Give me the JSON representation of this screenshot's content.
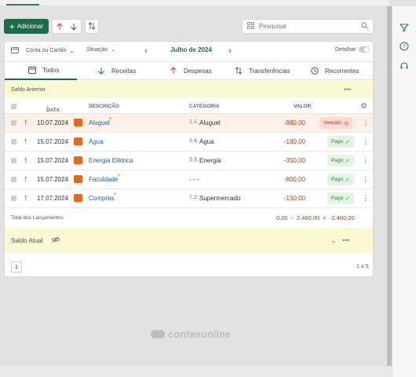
{
  "toolbar": {
    "add_label": "Adicionar",
    "search_placeholder": "Pesquisar"
  },
  "filters": {
    "account": "Conta ou Cartão",
    "status": "Situação",
    "period": "Julho de 2024",
    "detail": "Detalhar"
  },
  "tabs": [
    {
      "label": "Todos",
      "active": true
    },
    {
      "label": "Receitas",
      "active": false
    },
    {
      "label": "Despesas",
      "active": false
    },
    {
      "label": "Transferências",
      "active": false
    },
    {
      "label": "Recorrentes",
      "active": false
    }
  ],
  "previous_balance_label": "Saldo Anterior",
  "table": {
    "headers": {
      "date": "DATA",
      "description": "DESCRIÇÃO",
      "category": "CATEGORIA",
      "value": "VALOR"
    },
    "rows": [
      {
        "date": "10.07.2024",
        "description": "Aluguel",
        "category_code": "1.1.",
        "category": "Aluguel",
        "value": "-980,00",
        "status": "Vencido",
        "overdue": true
      },
      {
        "date": "15.07.2024",
        "description": "Água",
        "category_code": "3.4.",
        "category": "Água",
        "value": "-180,00",
        "status": "Pago",
        "overdue": false
      },
      {
        "date": "15.07.2024",
        "description": "Energia Elétrica",
        "category_code": "3.3.",
        "category": "Energia",
        "value": "-350,00",
        "status": "Pago",
        "overdue": false
      },
      {
        "date": "15.07.2024",
        "description": "Faculdade",
        "category_code": "",
        "category": "- - -",
        "value": "-800,00",
        "status": "Pago",
        "overdue": false
      },
      {
        "date": "17.07.2024",
        "description": "Compras",
        "category_code": "7.2.",
        "category": "Supermercado",
        "value": "-150,00",
        "status": "Pago",
        "overdue": false
      }
    ]
  },
  "totals": {
    "label": "Total dos Lançamentos",
    "income": "0,00",
    "minus": "-",
    "expense": "2.460,00",
    "equals": "=",
    "result": "-2.460,00"
  },
  "current_balance_label": "Saldo Atual",
  "pagination": {
    "page": "1",
    "range": "1 a 5"
  },
  "brand": "contasonline",
  "colors": {
    "primary": "#1d6b47",
    "negative": "#b23a1c",
    "band": "#fbf8d4"
  }
}
